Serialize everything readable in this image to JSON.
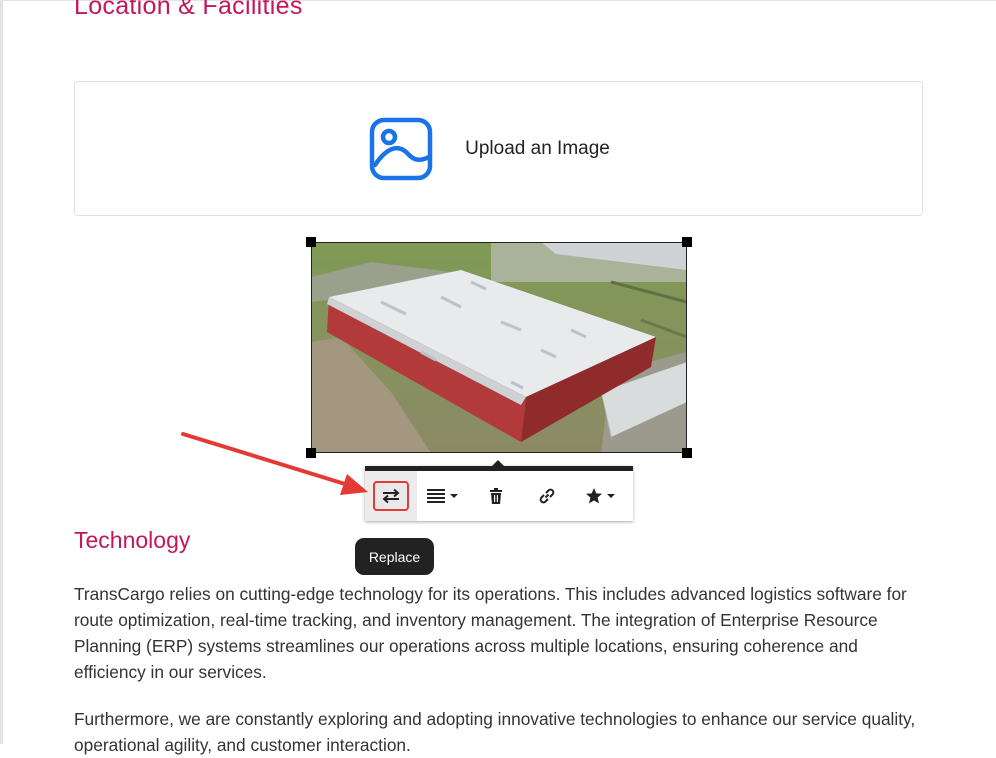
{
  "sections": {
    "location_heading": "Location & Facilities",
    "technology_heading": "Technology"
  },
  "upload": {
    "label": "Upload an Image",
    "icon": "image-icon"
  },
  "image": {
    "description_icon": "warehouse-photo"
  },
  "toolbar": {
    "buttons": [
      {
        "name": "replace",
        "icon": "swap-arrows-icon"
      },
      {
        "name": "align",
        "icon": "align-lines-icon"
      },
      {
        "name": "delete",
        "icon": "trash-icon"
      },
      {
        "name": "link",
        "icon": "link-icon"
      },
      {
        "name": "style",
        "icon": "star-icon"
      }
    ]
  },
  "tooltip": {
    "text": "Replace"
  },
  "content": {
    "paragraph1": "TransCargo relies on cutting-edge technology for its operations. This includes advanced logistics software for route optimization, real-time tracking, and inventory management. The integration of Enterprise Resource Planning (ERP) systems streamlines our operations across multiple locations, ensuring coherence and efficiency in our services.",
    "paragraph2": "Furthermore, we are constantly exploring and adopting innovative technologies to enhance our service quality, operational agility, and customer interaction."
  },
  "colors": {
    "heading": "#c2185b",
    "icon_blue": "#1a73e8",
    "annotation_red": "#e53935",
    "toolbar_dark": "#222222"
  }
}
